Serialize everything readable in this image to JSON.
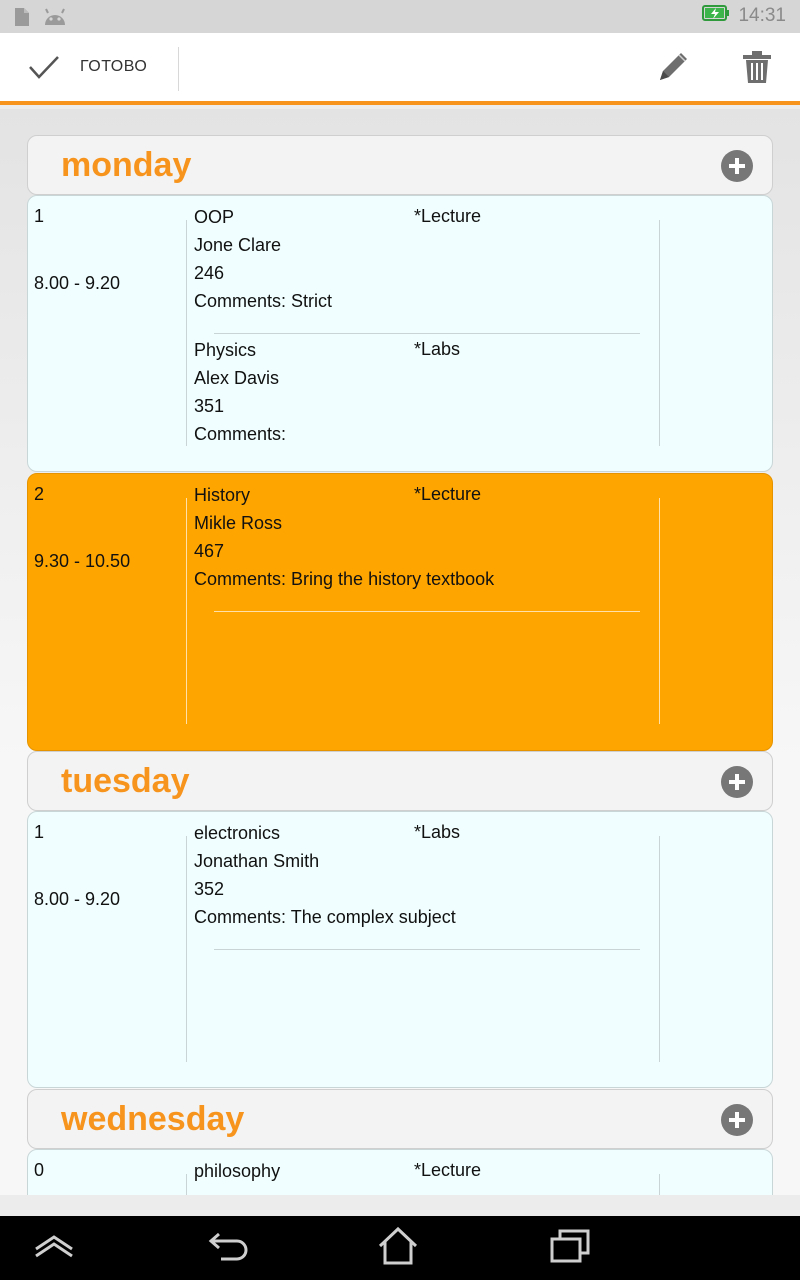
{
  "status_bar": {
    "time": "14:31",
    "icons": [
      "document-icon",
      "android-icon",
      "battery-charging-icon"
    ]
  },
  "action_bar": {
    "done_label": "ГОТОВО",
    "icons": [
      "check-icon",
      "pencil-icon",
      "trash-icon"
    ]
  },
  "colors": {
    "accent": "#f7941d",
    "selected_lesson": "#ffa500",
    "lesson_bg": "#f0feff"
  },
  "days": [
    {
      "name": "monday",
      "lessons": [
        {
          "number": "1",
          "time": "8.00 - 9.20",
          "entries": [
            {
              "subject": "OOP",
              "type": "*Lecture",
              "teacher": "Jone Clare",
              "room": "246",
              "comments": "Comments: Strict"
            },
            {
              "subject": "Physics",
              "type": "*Labs",
              "teacher": "Alex Davis",
              "room": "351",
              "comments": "Comments:"
            }
          ]
        },
        {
          "number": "2",
          "time": "9.30 - 10.50",
          "selected": true,
          "entries": [
            {
              "subject": "History",
              "type": "*Lecture",
              "teacher": "Mikle Ross",
              "room": "467",
              "comments": "Comments: Bring the history textbook"
            }
          ]
        }
      ]
    },
    {
      "name": "tuesday",
      "lessons": [
        {
          "number": "1",
          "time": "8.00 - 9.20",
          "entries": [
            {
              "subject": "electronics",
              "type": "*Labs",
              "teacher": "Jonathan Smith",
              "room": "352",
              "comments": "Comments: The complex subject"
            }
          ]
        }
      ]
    },
    {
      "name": "wednesday",
      "lessons": [
        {
          "number": "0",
          "entries": [
            {
              "subject": "philosophy",
              "type": "*Lecture"
            }
          ]
        }
      ]
    }
  ],
  "nav_bar": {
    "icons": [
      "back-icon",
      "home-icon",
      "recent-apps-icon",
      "collapse-icon"
    ]
  }
}
